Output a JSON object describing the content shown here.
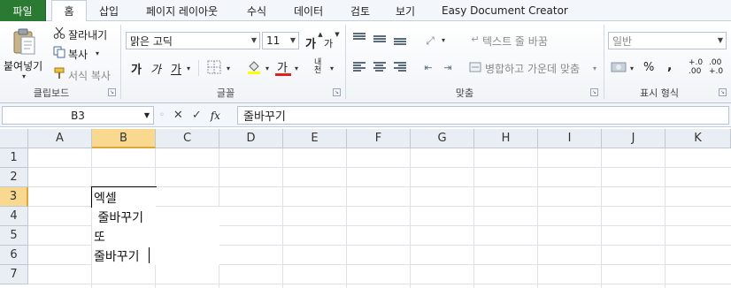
{
  "tabs": {
    "file": "파일",
    "home": "홈",
    "insert": "삽입",
    "page_layout": "페이지 레이아웃",
    "formulas": "수식",
    "data": "데이터",
    "review": "검토",
    "view": "보기",
    "addin": "Easy Document Creator"
  },
  "clipboard": {
    "paste": "붙여넣기",
    "cut": "잘라내기",
    "copy": "복사",
    "format_painter": "서식 복사",
    "label": "클립보드"
  },
  "font": {
    "name": "맑은 고딕",
    "size": "11",
    "grow": "가",
    "shrink": "가",
    "bold": "가",
    "italic": "가",
    "underline": "가",
    "font_color": "가",
    "phonetic": "내천",
    "label": "글꼴",
    "font_color_hex": "#e0201c"
  },
  "alignment": {
    "wrap_text": "텍스트 줄 바꿈",
    "merge_center": "병합하고 가운데 맞춤",
    "label": "맞춤"
  },
  "number": {
    "format": "일반",
    "percent": "%",
    "comma": ",",
    "inc_decimal": "+.0 .00",
    "dec_decimal": ".00 +.0",
    "label": "표시 형식"
  },
  "formula_bar": {
    "name_box": "B3",
    "fx": "fx",
    "content": "줄바꾸기"
  },
  "sheet": {
    "columns": [
      "A",
      "B",
      "C",
      "D",
      "E",
      "F",
      "G",
      "H",
      "I",
      "J",
      "K"
    ],
    "rows": [
      "1",
      "2",
      "3",
      "4",
      "5",
      "6",
      "7"
    ],
    "selected_column": "B",
    "selected_row": "3",
    "cells": {
      "B3": "엑셀",
      "B4": " 줄바꾸기",
      "B5": "또",
      "B6": "줄바꾸기"
    }
  },
  "colors": {
    "file_tab": "#2a7a33",
    "header_selected": "#f8d98f",
    "header_bg": "#e9eef4"
  }
}
